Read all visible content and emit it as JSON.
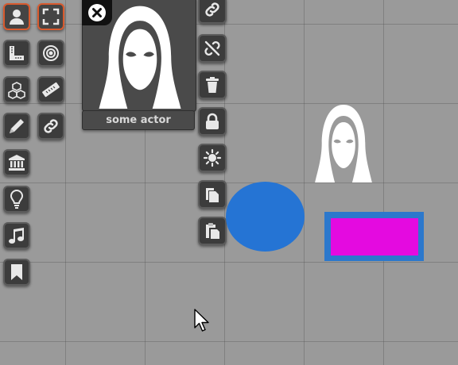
{
  "actor_panel": {
    "name": "some actor",
    "close_icon": "close-circle-icon",
    "portrait_icon": "hooded-figure-icon"
  },
  "left_toolbar": [
    {
      "id": "person",
      "icon": "person-icon",
      "active": true
    },
    {
      "id": "fullscreen",
      "icon": "fullscreen-icon",
      "active": true
    },
    {
      "id": "measure",
      "icon": "ruler-square-icon",
      "active": false
    },
    {
      "id": "target",
      "icon": "target-icon",
      "active": false
    },
    {
      "id": "boxes",
      "icon": "cubes-icon",
      "active": false
    },
    {
      "id": "ruler",
      "icon": "ruler-icon",
      "active": false
    },
    {
      "id": "pencil",
      "icon": "pencil-icon",
      "active": false
    },
    {
      "id": "link",
      "icon": "link-icon",
      "active": false
    },
    {
      "id": "bank",
      "icon": "bank-icon",
      "active": false
    },
    {
      "id": "lightbulb",
      "icon": "lightbulb-icon",
      "active": false
    },
    {
      "id": "music",
      "icon": "music-note-icon",
      "active": false
    },
    {
      "id": "bookmark",
      "icon": "bookmark-icon",
      "active": false
    }
  ],
  "right_toolbar": [
    {
      "id": "link",
      "icon": "link-icon"
    },
    {
      "id": "unlink",
      "icon": "unlink-icon"
    },
    {
      "id": "delete",
      "icon": "trash-icon"
    },
    {
      "id": "lock",
      "icon": "lock-icon"
    },
    {
      "id": "brightness",
      "icon": "sun-icon"
    },
    {
      "id": "copy",
      "icon": "copy-icon"
    },
    {
      "id": "paste",
      "icon": "paste-icon"
    }
  ],
  "colors": {
    "background": "#9a9a9a",
    "button": "#3c3c3c",
    "active_border": "#d85a2e",
    "ellipse": "#2574d4",
    "rect_border": "#2c78cc",
    "rect_fill": "#e40ae0"
  }
}
